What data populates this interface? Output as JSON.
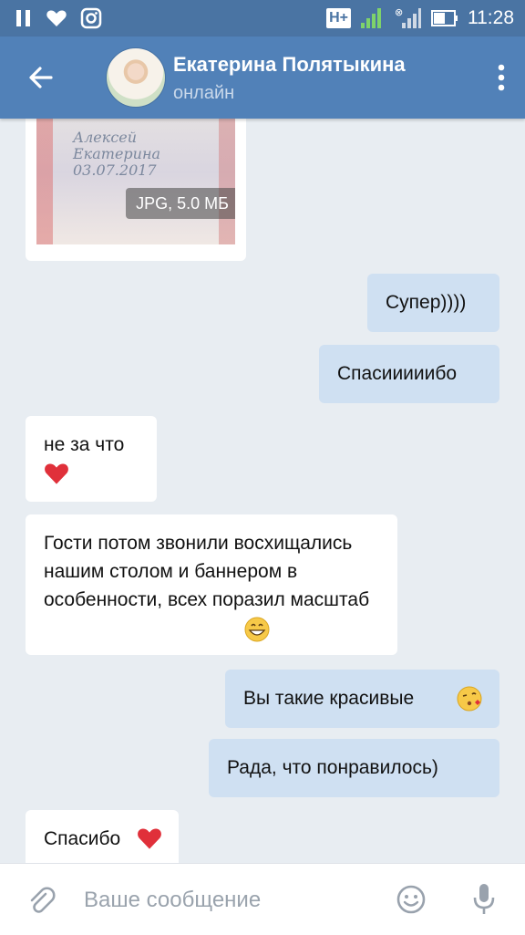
{
  "status_bar": {
    "time": "11:28",
    "network": "H+",
    "left_icons": [
      "pause-icon",
      "heart-icon",
      "instagram-icon"
    ],
    "right_icons": [
      "network-h-plus-icon",
      "signal-icon",
      "signal-no-sim-icon",
      "battery-icon"
    ]
  },
  "header": {
    "contact_name": "Екатерина Полятыкина",
    "contact_status": "онлайн",
    "icons": [
      "back-arrow-icon",
      "avatar",
      "more-vert-icon"
    ]
  },
  "messages": [
    {
      "side": "in",
      "type": "image",
      "badge": "JPG, 5.0 МБ",
      "script_text": "Алексей\nЕкатерина\n03.07.2017"
    },
    {
      "side": "out",
      "text": "Супер))))"
    },
    {
      "side": "out",
      "text": "Спасииииибо"
    },
    {
      "side": "in",
      "text": "не за что",
      "emoji": "heart"
    },
    {
      "side": "in",
      "text": "Гости потом звонили восхищались нашим столом и баннером в особенности, всех поразил масштаб",
      "emoji": "grin"
    },
    {
      "side": "out",
      "text": "Вы такие красивые",
      "emoji": "kiss"
    },
    {
      "side": "out",
      "text": "Рада, что понравилось)"
    },
    {
      "side": "in",
      "text": "Спасибо",
      "emoji": "heart"
    }
  ],
  "input_bar": {
    "placeholder": "Ваше сообщение",
    "icons": [
      "paperclip-icon",
      "smile-icon",
      "mic-icon"
    ]
  },
  "colors": {
    "header": "#5181b8",
    "status_bar": "#4a74a3",
    "chat_background": "#e8edf2",
    "incoming_bubble": "#ffffff",
    "outgoing_bubble": "#cfe0f2"
  }
}
